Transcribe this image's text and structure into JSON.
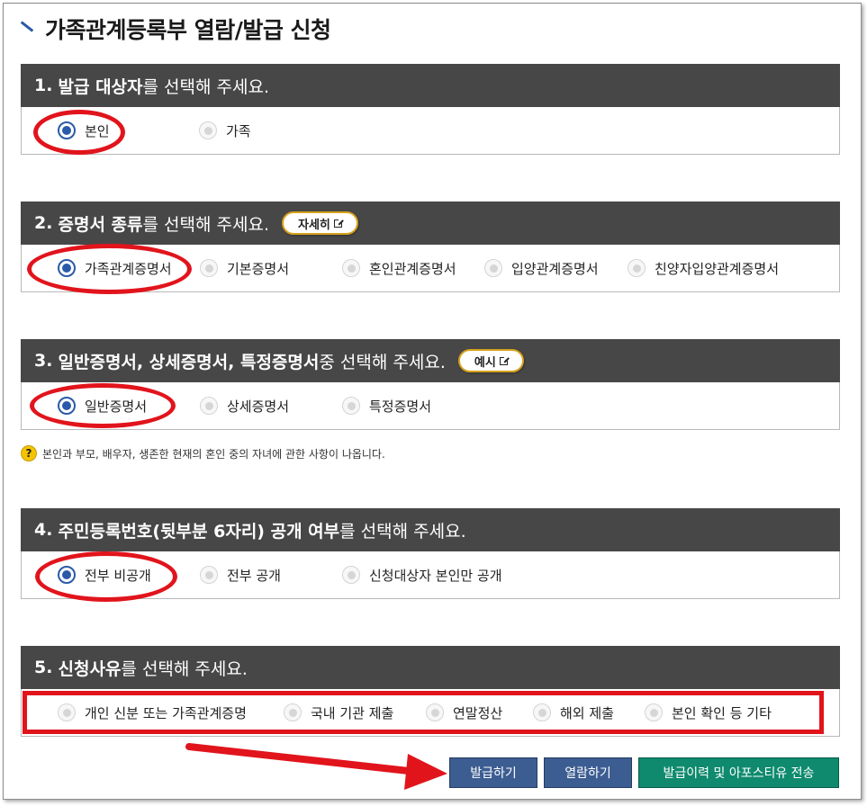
{
  "page": {
    "title": "가족관계등록부 열람/발급 신청",
    "accent_color": "#2b5aa8",
    "highlight_color": "#e1141c"
  },
  "sections": [
    {
      "number": "1.",
      "bold": "발급 대상자",
      "rest": "를 선택해 주세요.",
      "options": [
        "본인",
        "가족"
      ],
      "selected": "본인"
    },
    {
      "number": "2.",
      "bold": "증명서 종류",
      "rest": "를 선택해 주세요.",
      "button": "자세히",
      "options": [
        "가족관계증명서",
        "기본증명서",
        "혼인관계증명서",
        "입양관계증명서",
        "친양자입양관계증명서"
      ],
      "selected": "가족관계증명서"
    },
    {
      "number": "3.",
      "bold": "일반증명서, 상세증명서, 특정증명서",
      "rest": " 중 선택해 주세요.",
      "button": "예시",
      "options": [
        "일반증명서",
        "상세증명서",
        "특정증명서"
      ],
      "selected": "일반증명서"
    },
    {
      "number": "4.",
      "bold": "주민등록번호(뒷부분 6자리) 공개 여부",
      "rest": "를 선택해 주세요.",
      "options": [
        "전부 비공개",
        "전부 공개",
        "신청대상자 본인만 공개"
      ],
      "selected": "전부 비공개"
    },
    {
      "number": "5.",
      "bold": "신청사유",
      "rest": "를 선택해 주세요.",
      "options": [
        "개인 신분 또는 가족관계증명",
        "국내 기관 제출",
        "연말정산",
        "해외 제출",
        "본인 확인 등 기타"
      ],
      "selected": ""
    }
  ],
  "note": {
    "icon": "help-icon",
    "text": "본인과 부모, 배우자, 생존한 현재의 혼인 중의 자녀에 관한 사항이 나옵니다."
  },
  "actions": {
    "issue": "발급하기",
    "view": "열람하기",
    "history": "발급이력 및 아포스티유 전송"
  }
}
